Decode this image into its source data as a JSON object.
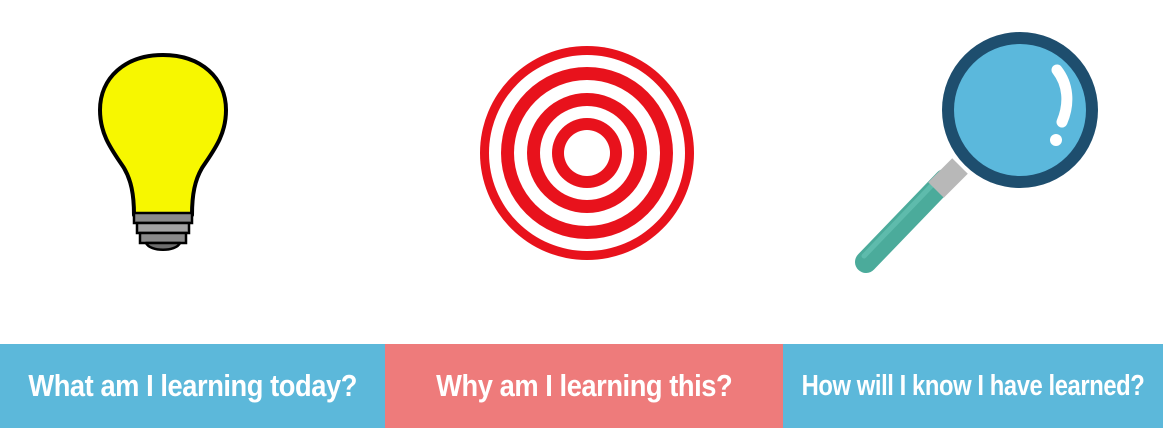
{
  "colors": {
    "blue_panel": "#5cb8da",
    "pink_panel": "#ee7b7b",
    "bulb_yellow": "#f7f700",
    "target_red": "#e8121c",
    "lens_blue": "#5bb8dc",
    "frame_navy": "#1e4e6e",
    "handle_teal": "#4bab9b"
  },
  "icons": {
    "first": "lightbulb-icon",
    "second": "target-icon",
    "third": "magnifying-glass-icon"
  },
  "panels": [
    {
      "label": "What am I learning today?"
    },
    {
      "label": "Why am I learning this?"
    },
    {
      "label": "How will I know I have learned?"
    }
  ]
}
